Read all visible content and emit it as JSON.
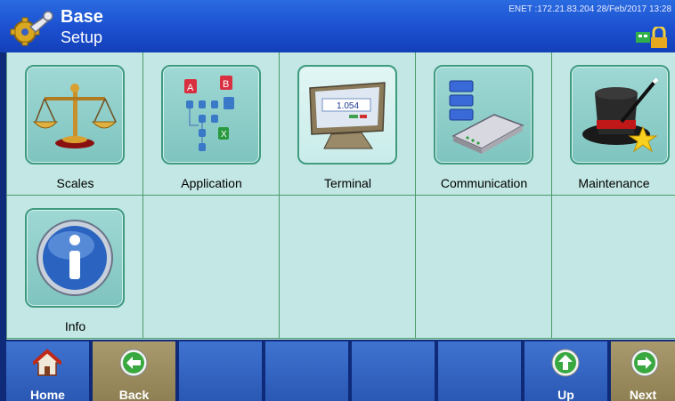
{
  "header": {
    "title": "Base",
    "subtitle": "Setup",
    "status": "ENET :172.21.83.204  28/Feb/2017 13:28",
    "logo_icon": "wrench-gear-icon",
    "status_icons": "network-lock-icon"
  },
  "grid": {
    "items": [
      {
        "label": "Scales",
        "icon": "balance-scale-icon"
      },
      {
        "label": "Application",
        "icon": "application-tree-icon"
      },
      {
        "label": "Terminal",
        "icon": "terminal-icon"
      },
      {
        "label": "Communication",
        "icon": "modem-icon"
      },
      {
        "label": "Maintenance",
        "icon": "magic-hat-icon"
      },
      {
        "label": "Info",
        "icon": "info-icon"
      }
    ]
  },
  "toolbar": {
    "home": "Home",
    "back": "Back",
    "up": "Up",
    "next": "Next"
  },
  "colors": {
    "header": "#1b4fd0",
    "grid_bg": "#c2e7e4",
    "toolbar_blue": "#2a58b4",
    "toolbar_brown": "#8e8052"
  }
}
